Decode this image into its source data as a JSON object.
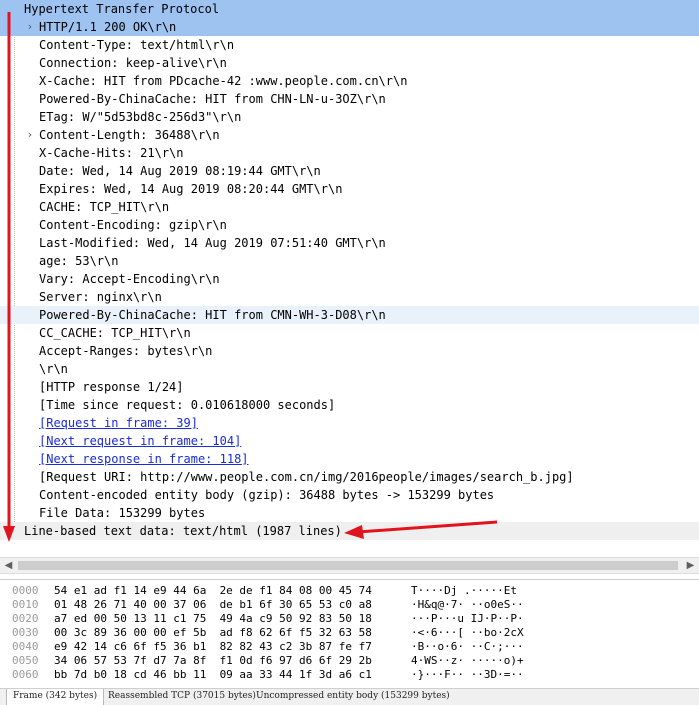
{
  "packet_tree": {
    "rows": [
      {
        "text": "Hypertext Transfer Protocol",
        "indent": 0,
        "expander": "",
        "style": "sel",
        "link": false
      },
      {
        "text": "HTTP/1.1 200 OK\\r\\n",
        "indent": 1,
        "expander": "›",
        "style": "sel",
        "link": false
      },
      {
        "text": "Content-Type: text/html\\r\\n",
        "indent": 1,
        "expander": "",
        "style": "",
        "link": false
      },
      {
        "text": "Connection: keep-alive\\r\\n",
        "indent": 1,
        "expander": "",
        "style": "",
        "link": false
      },
      {
        "text": "X-Cache: HIT from PDcache-42 :www.people.com.cn\\r\\n",
        "indent": 1,
        "expander": "",
        "style": "",
        "link": false
      },
      {
        "text": "Powered-By-ChinaCache: HIT from CHN-LN-u-3OZ\\r\\n",
        "indent": 1,
        "expander": "",
        "style": "",
        "link": false
      },
      {
        "text": "ETag: W/\"5d53bd8c-256d3\"\\r\\n",
        "indent": 1,
        "expander": "",
        "style": "",
        "link": false
      },
      {
        "text": "Content-Length: 36488\\r\\n",
        "indent": 1,
        "expander": "›",
        "style": "",
        "link": false
      },
      {
        "text": "X-Cache-Hits: 21\\r\\n",
        "indent": 1,
        "expander": "",
        "style": "",
        "link": false
      },
      {
        "text": "Date: Wed, 14 Aug 2019 08:19:44 GMT\\r\\n",
        "indent": 1,
        "expander": "",
        "style": "",
        "link": false
      },
      {
        "text": "Expires: Wed, 14 Aug 2019 08:20:44 GMT\\r\\n",
        "indent": 1,
        "expander": "",
        "style": "",
        "link": false
      },
      {
        "text": "CACHE: TCP_HIT\\r\\n",
        "indent": 1,
        "expander": "",
        "style": "",
        "link": false
      },
      {
        "text": "Content-Encoding: gzip\\r\\n",
        "indent": 1,
        "expander": "",
        "style": "",
        "link": false
      },
      {
        "text": "Last-Modified: Wed, 14 Aug 2019 07:51:40 GMT\\r\\n",
        "indent": 1,
        "expander": "",
        "style": "",
        "link": false
      },
      {
        "text": "age: 53\\r\\n",
        "indent": 1,
        "expander": "",
        "style": "",
        "link": false
      },
      {
        "text": "Vary: Accept-Encoding\\r\\n",
        "indent": 1,
        "expander": "",
        "style": "",
        "link": false
      },
      {
        "text": "Server: nginx\\r\\n",
        "indent": 1,
        "expander": "",
        "style": "",
        "link": false
      },
      {
        "text": "Powered-By-ChinaCache: HIT from CMN-WH-3-D08\\r\\n",
        "indent": 1,
        "expander": "",
        "style": "hl",
        "link": false
      },
      {
        "text": "CC_CACHE: TCP_HIT\\r\\n",
        "indent": 1,
        "expander": "",
        "style": "",
        "link": false
      },
      {
        "text": "Accept-Ranges: bytes\\r\\n",
        "indent": 1,
        "expander": "",
        "style": "",
        "link": false
      },
      {
        "text": "\\r\\n",
        "indent": 1,
        "expander": "",
        "style": "",
        "link": false
      },
      {
        "text": "[HTTP response 1/24]",
        "indent": 1,
        "expander": "",
        "style": "",
        "link": false
      },
      {
        "text": "[Time since request: 0.010618000 seconds]",
        "indent": 1,
        "expander": "",
        "style": "",
        "link": false
      },
      {
        "text": "[Request in frame: 39]",
        "indent": 1,
        "expander": "",
        "style": "",
        "link": true
      },
      {
        "text": "[Next request in frame: 104]",
        "indent": 1,
        "expander": "",
        "style": "",
        "link": true
      },
      {
        "text": "[Next response in frame: 118]",
        "indent": 1,
        "expander": "",
        "style": "",
        "link": true
      },
      {
        "text": "[Request URI: http://www.people.com.cn/img/2016people/images/search_b.jpg]",
        "indent": 1,
        "expander": "",
        "style": "",
        "link": false
      },
      {
        "text": "Content-encoded entity body (gzip): 36488 bytes -> 153299 bytes",
        "indent": 1,
        "expander": "",
        "style": "",
        "link": false
      },
      {
        "text": "File Data: 153299 bytes",
        "indent": 1,
        "expander": "",
        "style": "",
        "link": false
      },
      {
        "text": "Line-based text data: text/html (1987 lines)",
        "indent": 0,
        "expander": "",
        "style": "tail",
        "link": false
      }
    ]
  },
  "hex_dump": {
    "rows": [
      {
        "offset": "0000",
        "bytes": "54 e1 ad f1 14 e9 44 6a  2e de f1 84 08 00 45 74",
        "ascii": "T····Dj .·····Et"
      },
      {
        "offset": "0010",
        "bytes": "01 48 26 71 40 00 37 06  de b1 6f 30 65 53 c0 a8",
        "ascii": "·H&q@·7· ··o0eS··"
      },
      {
        "offset": "0020",
        "bytes": "a7 ed 00 50 13 11 c1 75  49 4a c9 50 92 83 50 18",
        "ascii": "···P···u IJ·P··P·"
      },
      {
        "offset": "0030",
        "bytes": "00 3c 89 36 00 00 ef 5b  ad f8 62 6f f5 32 63 58",
        "ascii": "·<·6···[ ··bo·2cX"
      },
      {
        "offset": "0040",
        "bytes": "e9 42 14 c6 6f f5 36 b1  82 82 43 c2 3b 87 fe f7",
        "ascii": "·B··o·6· ··C·;···"
      },
      {
        "offset": "0050",
        "bytes": "34 06 57 53 7f d7 7a 8f  f1 0d f6 97 d6 6f 29 2b",
        "ascii": "4·WS··z· ·····o)+"
      },
      {
        "offset": "0060",
        "bytes": "bb 7d b0 18 cd 46 bb 11  09 aa 33 44 1f 3d a6 c1",
        "ascii": "·}···F·· ··3D·=··"
      }
    ]
  },
  "bottom_tabs": [
    {
      "label": "Frame (342 bytes)",
      "active": true
    },
    {
      "label": "Reassembled TCP (37015 bytes)",
      "active": false
    },
    {
      "label": "Uncompressed entity body (153299 bytes)",
      "active": false
    }
  ],
  "colors": {
    "selected_row": "#9ec3f1",
    "annotation_red": "#e0141c",
    "link": "#1a2cd8"
  },
  "icons": {
    "collapse": "chevron-right-icon",
    "scroll_left": "scroll-left-icon",
    "scroll_right": "scroll-right-icon"
  }
}
